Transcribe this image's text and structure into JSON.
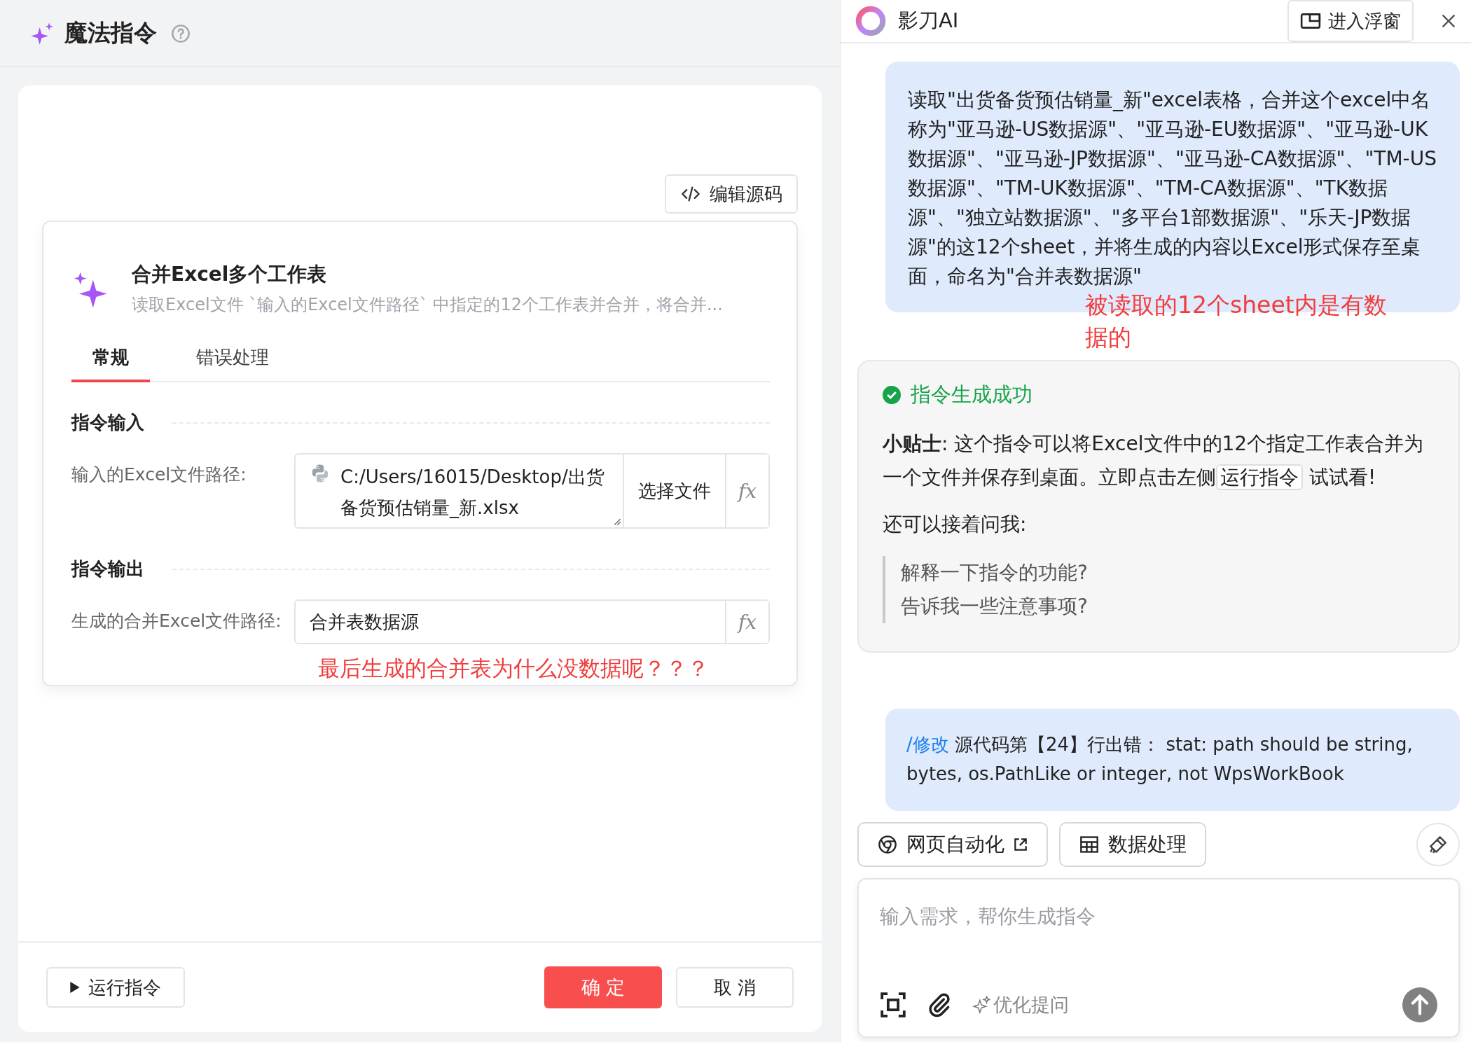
{
  "left": {
    "title": "魔法指令",
    "edit_source_button": "编辑源码",
    "command": {
      "title": "合并Excel多个工作表",
      "description": "读取Excel文件 `输入的Excel文件路径` 中指定的12个工作表并合并，将合并..."
    },
    "tabs": [
      {
        "label": "常规",
        "selected": true
      },
      {
        "label": "错误处理",
        "selected": false
      }
    ],
    "sections": [
      {
        "title": "指令输入",
        "fields": [
          {
            "kind": "file",
            "label": "输入的Excel文件路径:",
            "value": "C:/Users/16015/Desktop/出货备货预估销量_新.xlsx",
            "button": "选择文件",
            "fx": "fx"
          }
        ]
      },
      {
        "title": "指令输出",
        "fields": [
          {
            "kind": "text",
            "label": "生成的合并Excel文件路径:",
            "value": "合并表数据源",
            "fx": "fx"
          }
        ]
      }
    ],
    "annotation": "最后生成的合并表为什么没数据呢？？？",
    "footer": {
      "run_button": "运行指令",
      "ok_button": "确 定",
      "cancel_button": "取 消"
    }
  },
  "right": {
    "title": "影刀AI",
    "float_button": "进入浮窗",
    "user_message": "读取\"出货备货预估销量_新\"excel表格，合并这个excel中名称为\"亚马逊-US数据源\"、\"亚马逊-EU数据源\"、\"亚马逊-UK数据源\"、\"亚马逊-JP数据源\"、\"亚马逊-CA数据源\"、\"TM-US数据源\"、\"TM-UK数据源\"、\"TM-CA数据源\"、\"TK数据源\"、\"独立站数据源\"、\"多平台1部数据源\"、\"乐天-JP数据源\"的这12个sheet，并将生成的内容以Excel形式保存至桌面，命名为\"合并表数据源\"",
    "annotation": "被读取的12个sheet内是有数据的",
    "reply": {
      "status": "指令生成成功",
      "tip_before": "**小贴士**: 这个指令可以将Excel文件中的12个指定工作表合并为一个文件并保存到桌面。立即点击左侧",
      "tip_chip": "运行指令",
      "tip_after": "试试看!",
      "followup_label": "还可以接着问我:",
      "suggestions": [
        "解释一下指令的功能?",
        "告诉我一些注意事项?"
      ]
    },
    "error_message": {
      "command": "/修改",
      "text": "源代码第【24】行出错： stat: path should be string, bytes, os.PathLike or integer, not WpsWorkBook"
    },
    "chips": [
      "网页自动化",
      "数据处理"
    ],
    "input": {
      "placeholder": "输入需求，帮你生成指令",
      "optimize": "优化提问"
    }
  }
}
